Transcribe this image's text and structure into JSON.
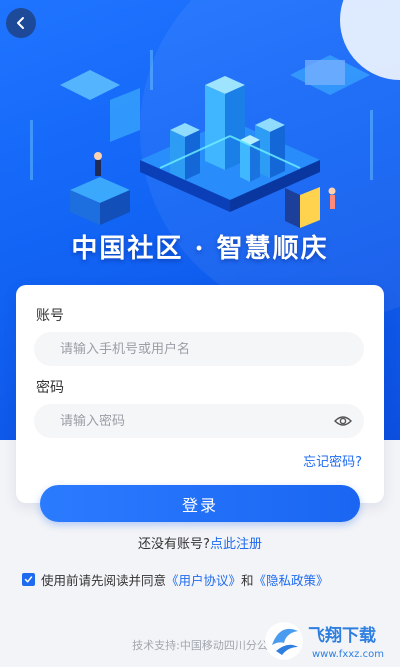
{
  "header": {
    "slogan": "中国社区 · 智慧顺庆"
  },
  "form": {
    "account_label": "账号",
    "account_placeholder": "请输入手机号或用户名",
    "password_label": "密码",
    "password_placeholder": "请输入密码",
    "forgot_label": "忘记密码?"
  },
  "login_button": "登录",
  "register": {
    "prompt": "还没有账号?",
    "link": "点此注册"
  },
  "agreement": {
    "checked": true,
    "prefix": "使用前请先阅读并同意",
    "user_agreement": "《用户协议》",
    "and": "和",
    "privacy_policy": "《隐私政策》"
  },
  "footer": {
    "support": "技术支持:中国移动四川分公"
  },
  "watermark": {
    "text": "飞翔下载",
    "url": "www.fxxz.com"
  },
  "colors": {
    "primary": "#1f6bf0",
    "hero": "#1264f5"
  },
  "icons": [
    "back-arrow-icon",
    "eye-icon",
    "checkmark-icon"
  ]
}
